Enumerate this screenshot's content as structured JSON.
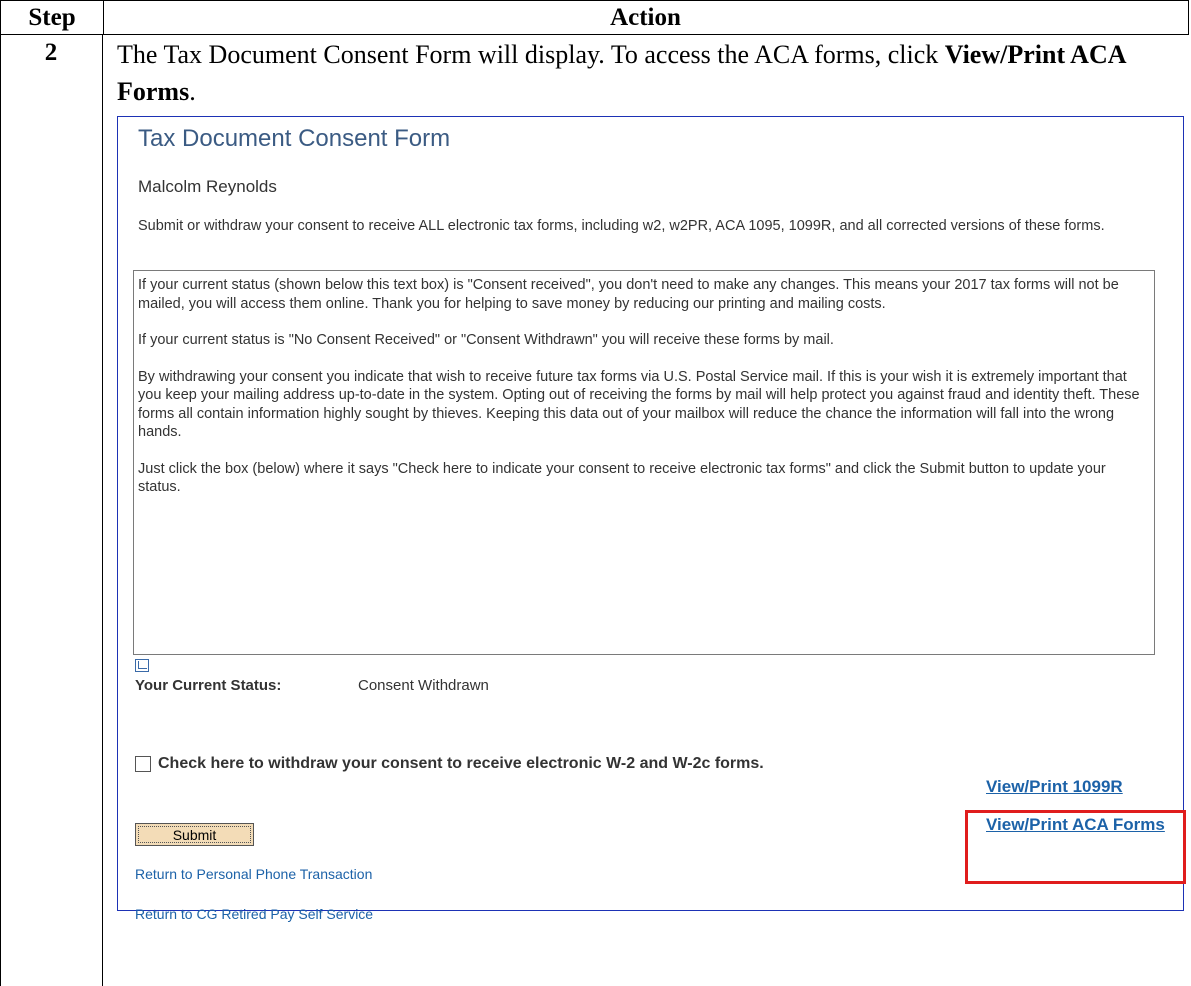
{
  "table": {
    "header_step": "Step",
    "header_action": "Action",
    "step_number": "2",
    "instruction_text": "The Tax Document Consent Form will display.  To access the ACA forms, click ",
    "instruction_bold": "View/Print ACA Forms",
    "instruction_end": "."
  },
  "screenshot": {
    "title": "Tax Document Consent Form",
    "name": "Malcolm Reynolds",
    "description": "Submit or withdraw your consent to receive ALL electronic tax forms, including w2, w2PR, ACA 1095, 1099R, and all corrected versions of these forms.",
    "textbox_paragraphs": [
      "If your current status (shown below this text box) is \"Consent received\", you don't need to make any changes. This means your 2017 tax forms will not be mailed, you will access them online. Thank you for helping to save money by reducing our printing and mailing costs.",
      "If your current status is \"No Consent Received\" or  \"Consent Withdrawn\" you will  receive these forms by mail.",
      "By withdrawing your consent you indicate that wish to receive future tax forms via U.S. Postal Service mail. If this is your wish it is extremely important that you keep your mailing address up-to-date in the system. Opting out of receiving the forms by mail will help protect you against fraud and identity theft. These forms all contain information highly sought by thieves. Keeping this data out of your mailbox will reduce the chance the information will fall into the wrong hands.",
      "Just click the box (below) where it says \"Check here to indicate your consent to receive electronic tax forms\" and click the Submit button to update your status."
    ],
    "status_label": "Your Current Status:",
    "status_value": "Consent Withdrawn",
    "checkbox_label": "Check here to withdraw your consent to receive electronic W-2 and W-2c forms.",
    "link_1099r": "View/Print 1099R",
    "link_aca": "View/Print ACA Forms",
    "submit_label": "Submit",
    "return_link_1": "Return to Personal Phone Transaction",
    "return_link_2": "Return to CG Retired Pay Self Service"
  }
}
